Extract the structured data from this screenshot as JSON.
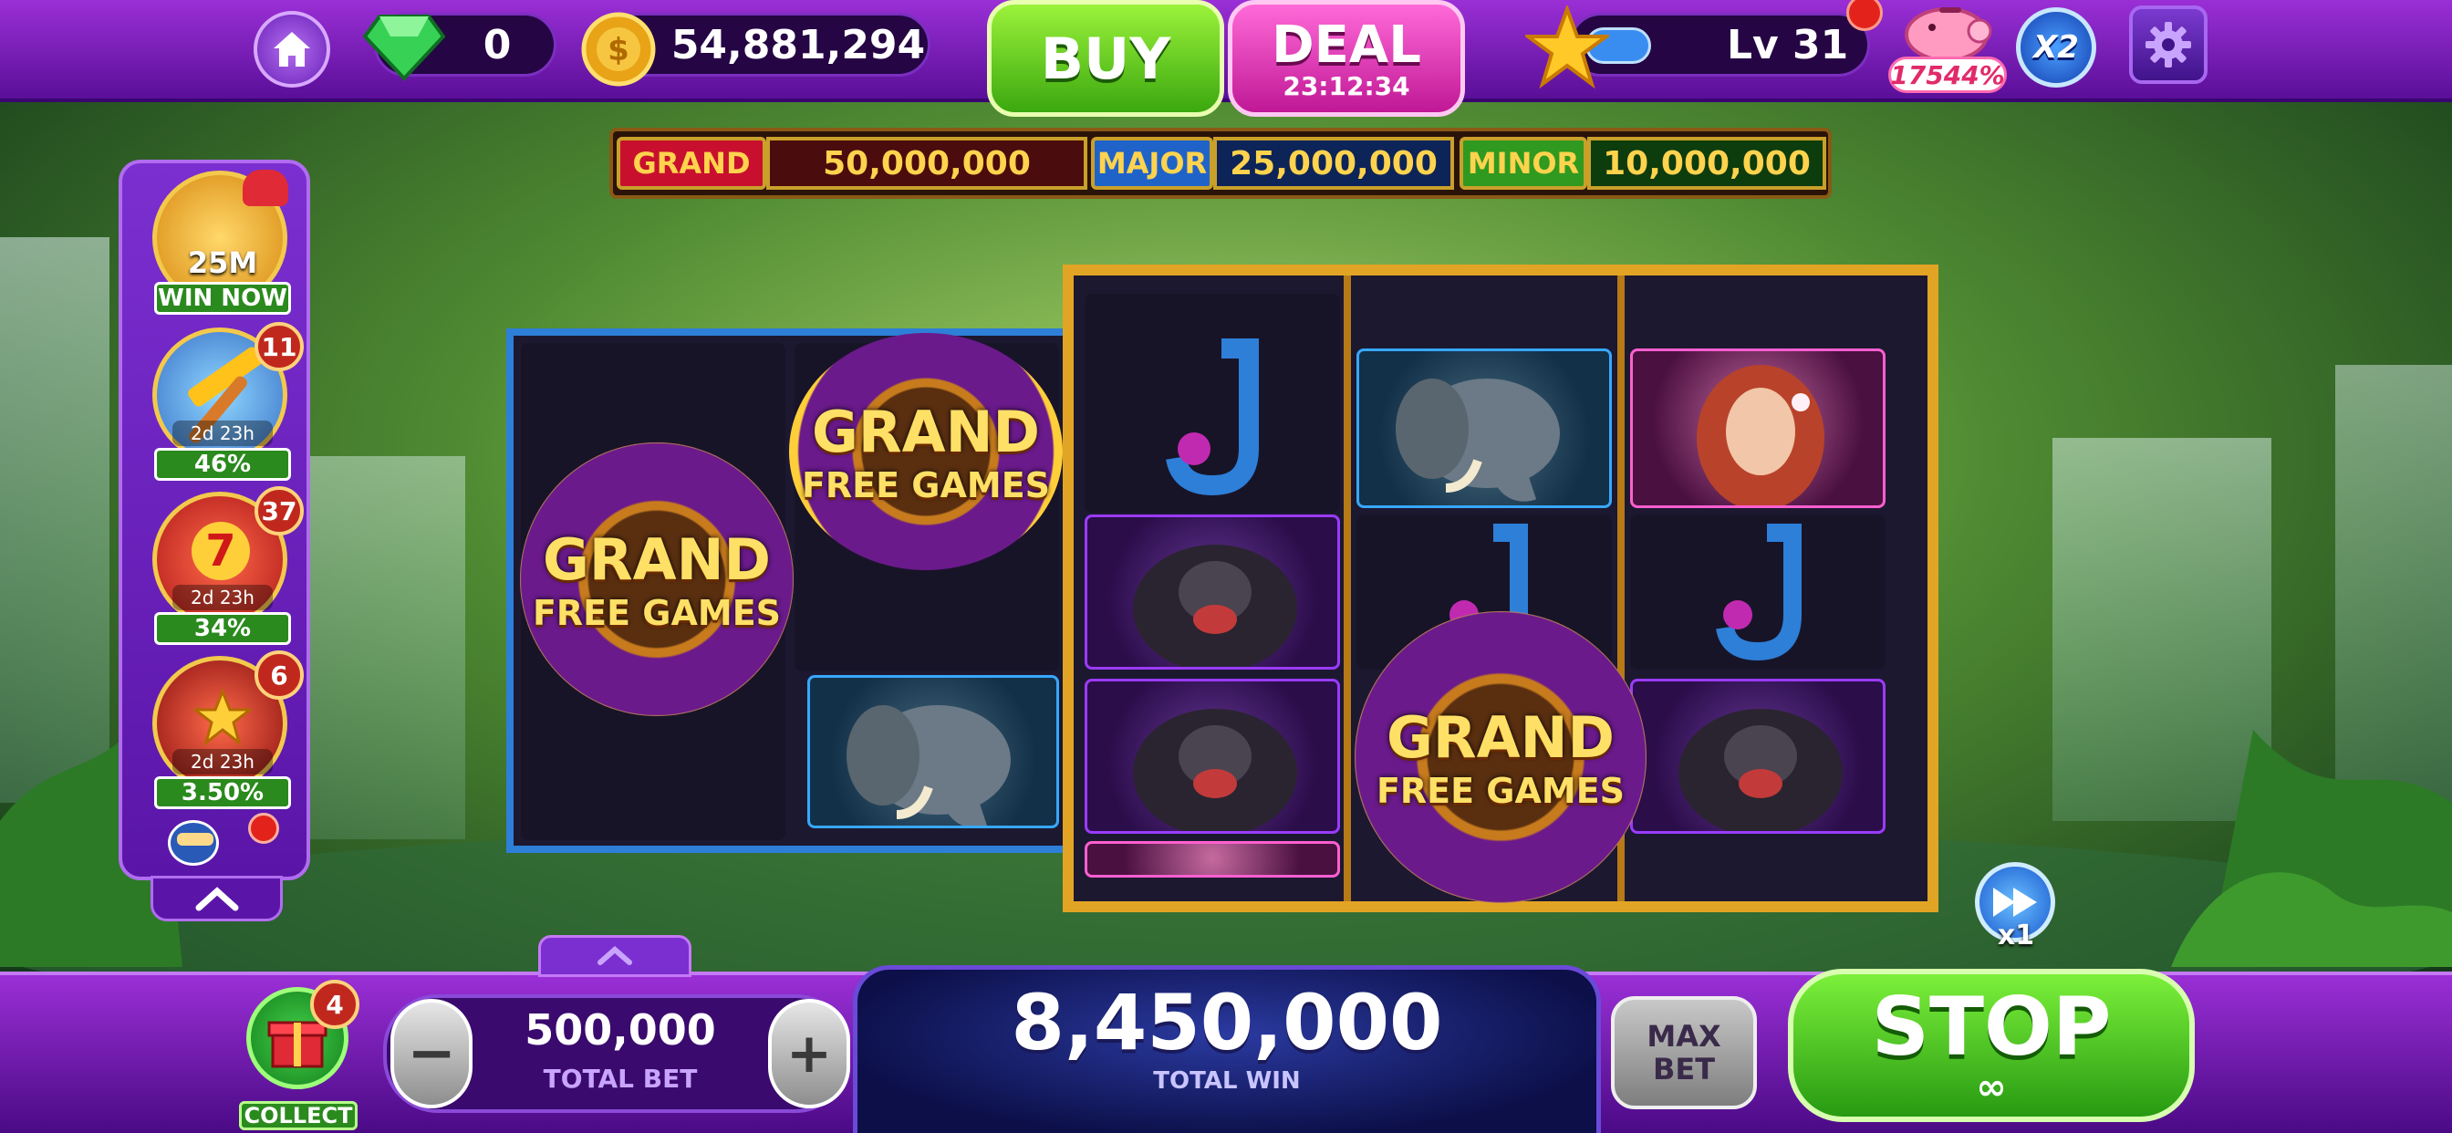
{
  "topbar": {
    "gems": "0",
    "coins": "54,881,294",
    "buy_label": "BUY",
    "deal_label": "DEAL",
    "deal_timer": "23:12:34",
    "level": "Lv 31",
    "piggy_percent": "17544%",
    "multiplier": "X2",
    "icons": [
      "home-icon",
      "gem-icon",
      "coin-icon",
      "star-icon",
      "piggy-bank-icon",
      "settings-gear-icon"
    ]
  },
  "jackpots": [
    {
      "label": "GRAND",
      "value": "50,000,000",
      "color": "#c8102e"
    },
    {
      "label": "MAJOR",
      "value": "25,000,000",
      "color": "#1f63c9"
    },
    {
      "label": "MINOR",
      "value": "10,000,000",
      "color": "#2f9a1f"
    }
  ],
  "left_panel": {
    "items": [
      {
        "top_text": "25M",
        "bottom_text": "WIN NOW"
      },
      {
        "timer": "2d 23h",
        "progress": "46%",
        "badge": "11"
      },
      {
        "timer": "2d 23h",
        "progress": "34%",
        "badge": "37"
      },
      {
        "timer": "2d 23h",
        "progress": "3.50%",
        "badge": "6"
      }
    ]
  },
  "reels": {
    "wheel_title": "GRAND",
    "wheel_subtitle": "FREE GAMES"
  },
  "speed": {
    "label": "x1"
  },
  "bottom": {
    "collect_badge": "4",
    "collect_label": "COLLECT",
    "minus_label": "−",
    "plus_label": "+",
    "total_bet_value": "500,000",
    "total_bet_label": "TOTAL BET",
    "total_win_value": "8,450,000",
    "total_win_label": "TOTAL WIN",
    "max_bet_line1": "MAX",
    "max_bet_line2": "BET",
    "stop_label": "STOP",
    "stop_sub": "∞"
  }
}
